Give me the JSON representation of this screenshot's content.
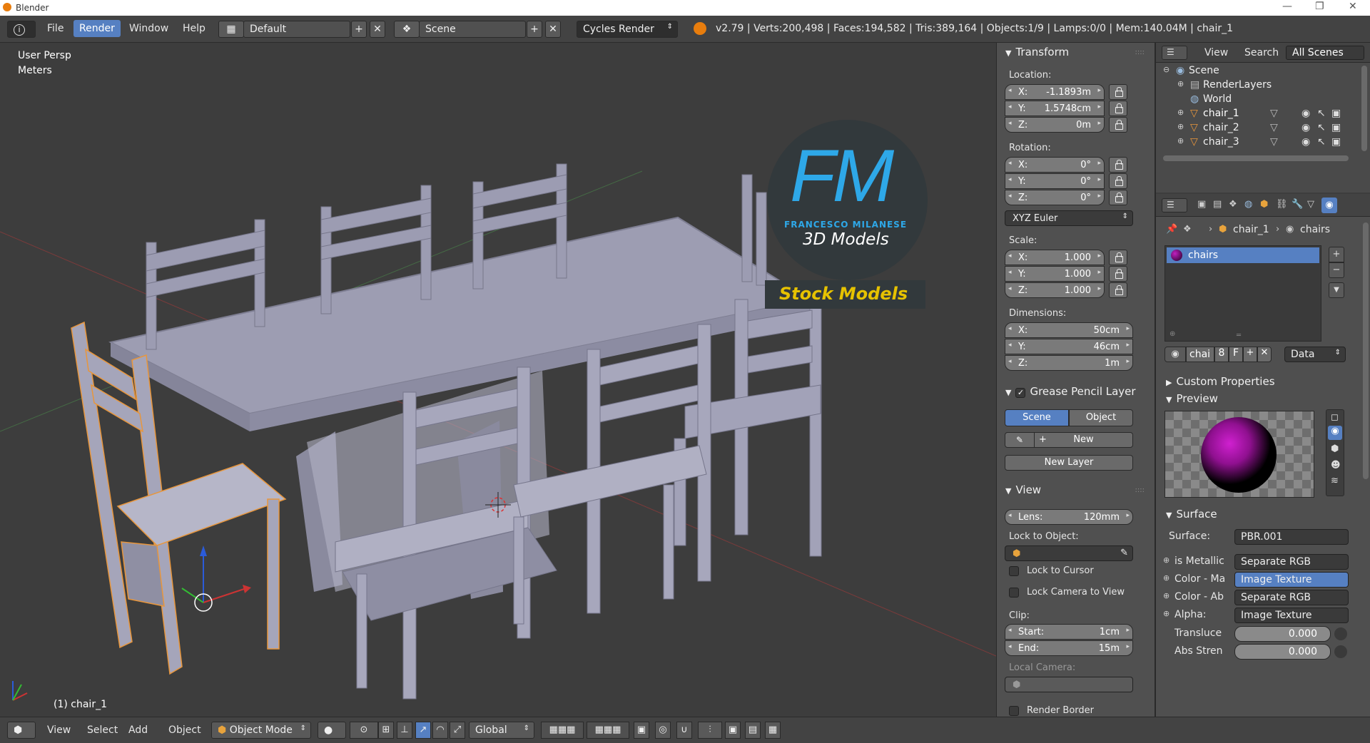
{
  "os": {
    "title": "Blender",
    "min": "—",
    "restore": "❐",
    "close": "✕"
  },
  "topbar": {
    "info_icon": "i",
    "menus": [
      "File",
      "Render",
      "Window",
      "Help"
    ],
    "active_menu": "Render",
    "layout": "Default",
    "scene": "Scene",
    "engine": "Cycles Render",
    "stats": "v2.79 | Verts:200,498 | Faces:194,582 | Tris:389,164 | Objects:1/9 | Lamps:0/0 | Mem:140.04M | chair_1"
  },
  "viewport": {
    "view_name": "User Persp",
    "units": "Meters",
    "active_object": "(1) chair_1",
    "watermark": {
      "big": "FM",
      "brand": "FRANCESCO MILANESE",
      "sub": "3D Models",
      "banner": "Stock Models"
    }
  },
  "transform": {
    "title": "Transform",
    "location_label": "Location:",
    "location": [
      {
        "k": "X:",
        "v": "-1.1893m"
      },
      {
        "k": "Y:",
        "v": "1.5748cm"
      },
      {
        "k": "Z:",
        "v": "0m"
      }
    ],
    "rotation_label": "Rotation:",
    "rotation": [
      {
        "k": "X:",
        "v": "0°"
      },
      {
        "k": "Y:",
        "v": "0°"
      },
      {
        "k": "Z:",
        "v": "0°"
      }
    ],
    "rotation_mode": "XYZ Euler",
    "scale_label": "Scale:",
    "scale": [
      {
        "k": "X:",
        "v": "1.000"
      },
      {
        "k": "Y:",
        "v": "1.000"
      },
      {
        "k": "Z:",
        "v": "1.000"
      }
    ],
    "dimensions_label": "Dimensions:",
    "dimensions": [
      {
        "k": "X:",
        "v": "50cm"
      },
      {
        "k": "Y:",
        "v": "46cm"
      },
      {
        "k": "Z:",
        "v": "1m"
      }
    ]
  },
  "grease": {
    "title": "Grease Pencil Layer",
    "tab_scene": "Scene",
    "tab_object": "Object",
    "new": "New",
    "new_layer": "New Layer"
  },
  "view": {
    "title": "View",
    "lens_k": "Lens:",
    "lens_v": "120mm",
    "lock_obj_label": "Lock to Object:",
    "lock_cursor": "Lock to Cursor",
    "lock_camera": "Lock Camera to View",
    "clip_label": "Clip:",
    "clip_start_k": "Start:",
    "clip_start_v": "1cm",
    "clip_end_k": "End:",
    "clip_end_v": "15m",
    "local_camera": "Local Camera:",
    "render_border": "Render Border"
  },
  "outliner": {
    "view": "View",
    "search": "Search",
    "scenes": "All Scenes",
    "rows": [
      {
        "label": "Scene"
      },
      {
        "label": "RenderLayers"
      },
      {
        "label": "World"
      },
      {
        "label": "chair_1"
      },
      {
        "label": "chair_2"
      },
      {
        "label": "chair_3"
      }
    ]
  },
  "properties": {
    "breadcrumb_obj": "chair_1",
    "breadcrumb_mat": "chairs",
    "slot": "chairs",
    "mat_name": "chai",
    "mat_users": "8",
    "mat_fake": "F",
    "link": "Data",
    "custom_props": "Custom Properties",
    "preview": "Preview",
    "surface_head": "Surface",
    "surface_label": "Surface:",
    "surface_value": "PBR.001",
    "inputs": [
      {
        "label": "is Metallic",
        "value": "Separate RGB"
      },
      {
        "label": "Color - Ma",
        "value": "Image Texture"
      },
      {
        "label": "Color - Ab",
        "value": "Separate RGB"
      },
      {
        "label": "Alpha:",
        "value": "Image Texture"
      }
    ],
    "translucent_label": "Transluce",
    "translucent_value": "0.000",
    "abs_label": "Abs Stren",
    "abs_value": "0.000"
  },
  "bottombar": {
    "menus": [
      "View",
      "Select",
      "Add",
      "Object"
    ],
    "mode": "Object Mode",
    "orientation": "Global"
  },
  "colors": {
    "accent": "#5680c2",
    "viewport_bg": "#3d3d3d",
    "mesh": "#9b9bb0",
    "selected_outline": "#e8963c"
  }
}
